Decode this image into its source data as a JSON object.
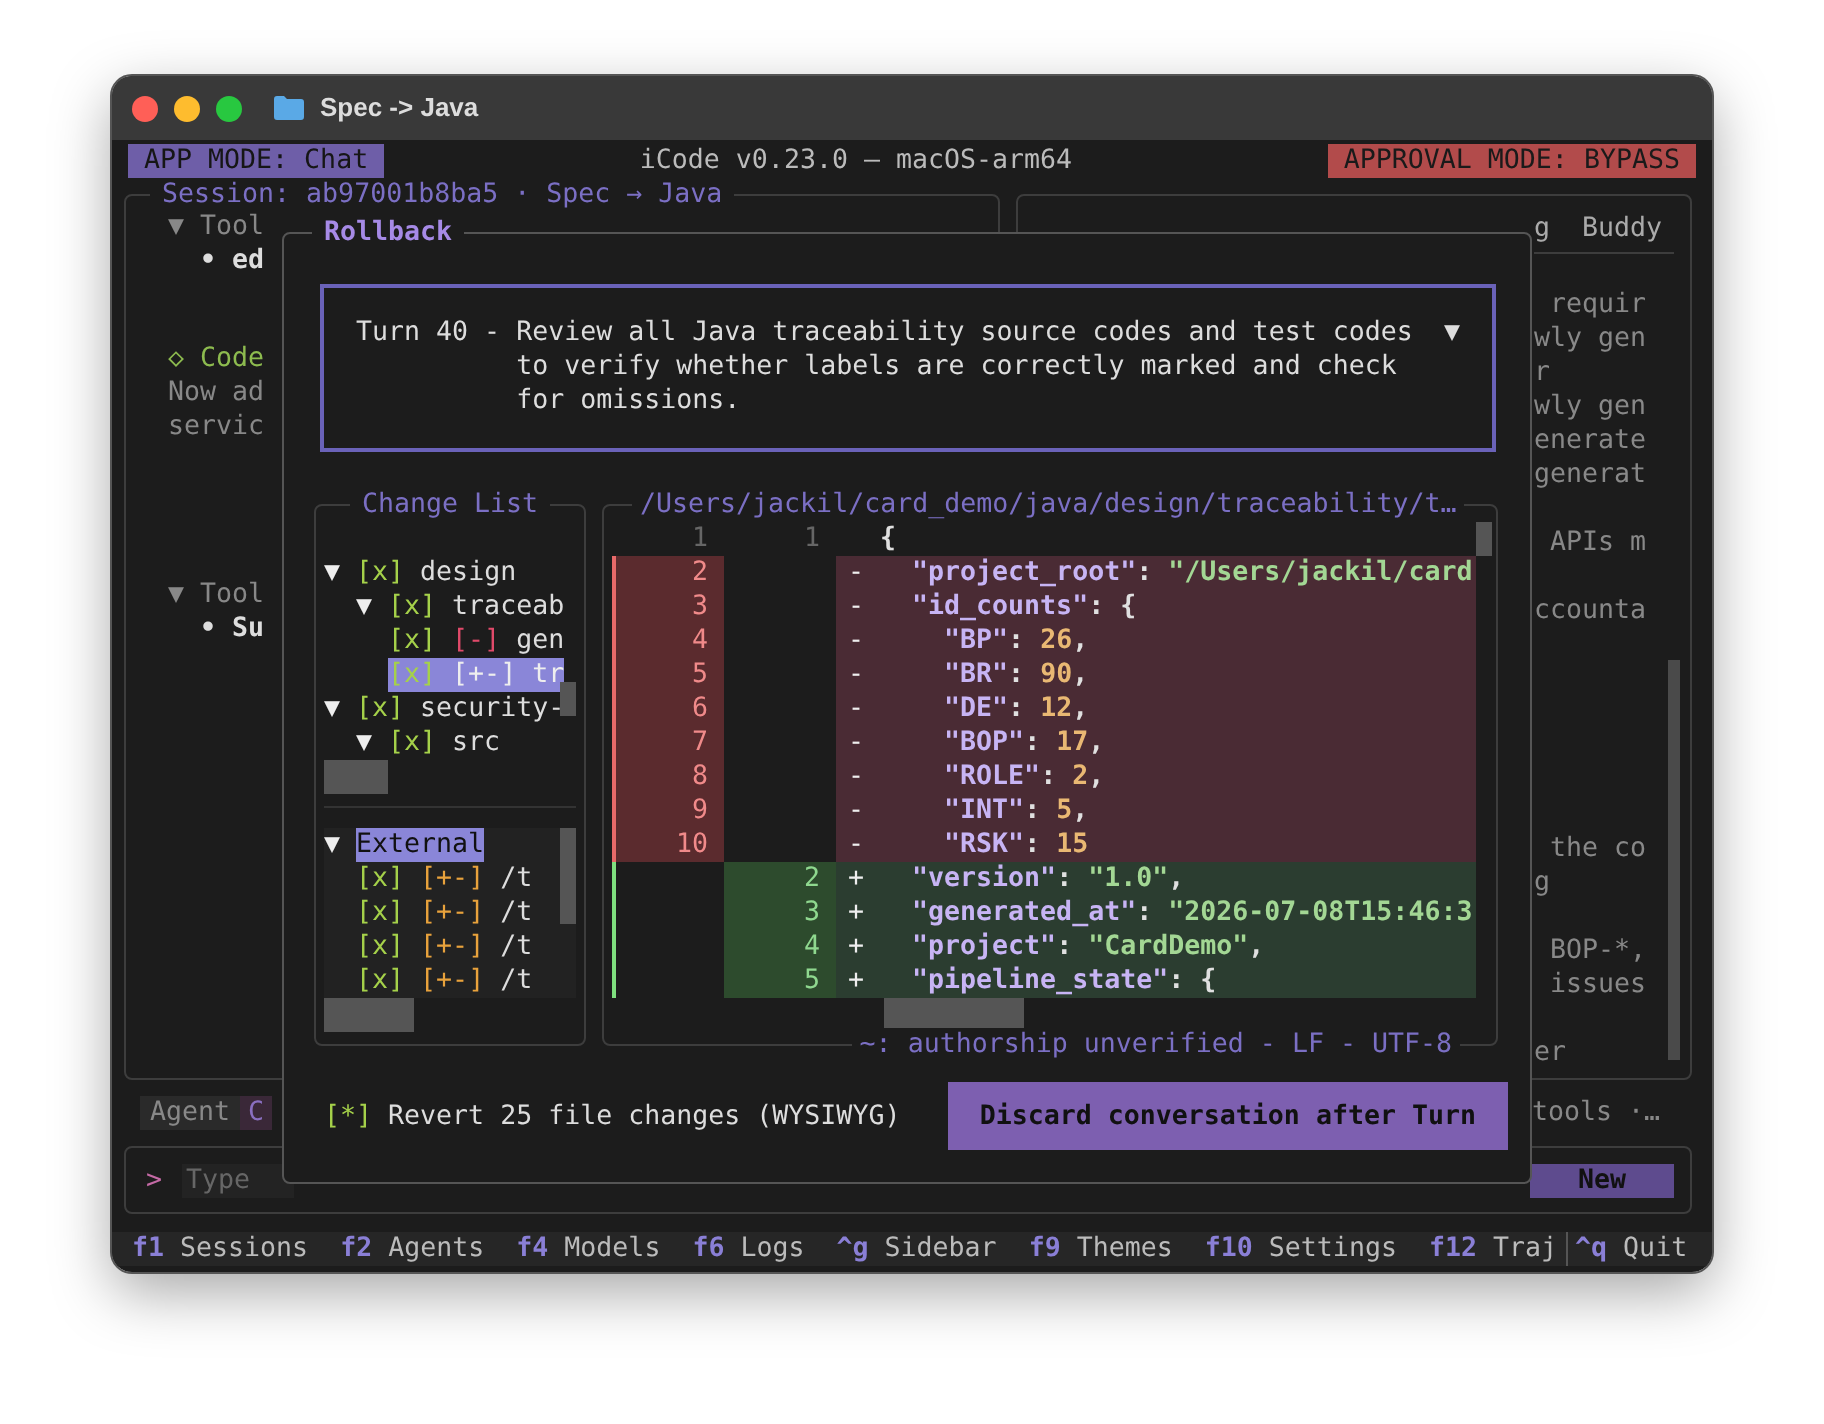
{
  "window": {
    "title": "Spec -> Java"
  },
  "header": {
    "app_mode": "APP MODE: Chat",
    "title": "iCode v0.23.0 — macOS-arm64",
    "approval_mode": "APPROVAL MODE: BYPASS"
  },
  "session_panel": {
    "title": "Session: ab97001b8ba5 · Spec → Java",
    "blocks": [
      {
        "kind": "tool",
        "lines": [
          "▼ Tool",
          "• ed"
        ]
      },
      {
        "kind": "message",
        "lines": [
          "◇ Code",
          "Now ad",
          "servic"
        ]
      },
      {
        "kind": "tool",
        "lines": [
          "▼ Tool",
          "• Su"
        ]
      }
    ]
  },
  "side_panel": {
    "tabs": [
      "g",
      "Buddy"
    ],
    "paragraphs": [
      [
        " requir",
        "wly gen",
        "r",
        "wly gen",
        "enerate",
        "generat"
      ],
      [
        " APIs m"
      ],
      [
        "ccounta"
      ],
      [
        " the co",
        "g"
      ],
      [
        " BOP-*,",
        " issues"
      ],
      [
        "er"
      ]
    ]
  },
  "agent_bar": {
    "label": "Agent",
    "value": "C",
    "tools": "tools ·…"
  },
  "input": {
    "prompt": ">",
    "placeholder": "Type",
    "button": "New"
  },
  "status_bar": [
    {
      "key": "f1",
      "label": "Sessions"
    },
    {
      "key": "f2",
      "label": "Agents"
    },
    {
      "key": "f4",
      "label": "Models"
    },
    {
      "key": "f6",
      "label": "Logs"
    },
    {
      "key": "^g",
      "label": "Sidebar"
    },
    {
      "key": "f9",
      "label": "Themes"
    },
    {
      "key": "f10",
      "label": "Settings"
    },
    {
      "key": "f12",
      "label": "Traj"
    },
    {
      "key": "^q",
      "label": "Quit"
    }
  ],
  "rollback": {
    "title": "Rollback",
    "turn": {
      "label": "Turn 40 -",
      "text": "Review all Java traceability source codes and test codes to verify whether labels are correctly marked and check for omissions.",
      "toggle": "▼"
    },
    "change_list": {
      "title": "Change List",
      "groups": [
        [
          {
            "toggle": "▼",
            "check": "[x]",
            "checked": true,
            "label": "design",
            "selected": false,
            "children": [
              {
                "toggle": "▼",
                "check": "[x]",
                "checked": true,
                "label": "traceab",
                "selected": false,
                "children": [
                  {
                    "check": "[x]",
                    "checked": true,
                    "change": "[-]",
                    "color": "#e04a6a",
                    "label": "gen",
                    "selected": false
                  },
                  {
                    "check": "[x]",
                    "checked": true,
                    "change": "[+-]",
                    "label": "tr",
                    "selected": true
                  }
                ]
              }
            ]
          },
          {
            "toggle": "▼",
            "check": "[x]",
            "checked": true,
            "label": "security-",
            "selected": false,
            "children": [
              {
                "toggle": "▼",
                "check": "[x]",
                "checked": true,
                "label": "src",
                "selected": false
              }
            ]
          }
        ],
        [
          {
            "toggle": "▼",
            "label": "External",
            "selected": true,
            "children": [
              {
                "check": "[x]",
                "checked": true,
                "change": "[+-]",
                "color": "#e8a23c",
                "label": "/t",
                "selected": false
              },
              {
                "check": "[x]",
                "checked": true,
                "change": "[+-]",
                "color": "#e8a23c",
                "label": "/t",
                "selected": false
              },
              {
                "check": "[x]",
                "checked": true,
                "change": "[+-]",
                "color": "#e8a23c",
                "label": "/t",
                "selected": false
              },
              {
                "check": "[x]",
                "checked": true,
                "change": "[+-]",
                "color": "#e8a23c",
                "label": "/t",
                "selected": false
              }
            ]
          }
        ]
      ]
    },
    "diff": {
      "title": "/Users/jackil/card_demo/java/design/traceability/t…",
      "footer": "~: authorship unverified - LF - UTF-8",
      "rows": [
        {
          "kind": "context",
          "old": "1",
          "new": "1",
          "tokens": [
            {
              "kind": "punct",
              "text": "{"
            }
          ]
        },
        {
          "kind": "removed",
          "old": "2",
          "sign": "-",
          "tokens": [
            {
              "kind": "key",
              "text": "  \"project_root\""
            },
            {
              "kind": "punct",
              "text": ": "
            },
            {
              "kind": "str",
              "text": "\"/Users/jackil/card"
            }
          ]
        },
        {
          "kind": "removed",
          "old": "3",
          "sign": "-",
          "tokens": [
            {
              "kind": "key",
              "text": "  \"id_counts\""
            },
            {
              "kind": "punct",
              "text": ": {"
            }
          ]
        },
        {
          "kind": "removed",
          "old": "4",
          "sign": "-",
          "tokens": [
            {
              "kind": "key",
              "text": "    \"BP\""
            },
            {
              "kind": "punct",
              "text": ": "
            },
            {
              "kind": "num",
              "text": "26"
            },
            {
              "kind": "punct",
              "text": ","
            }
          ]
        },
        {
          "kind": "removed",
          "old": "5",
          "sign": "-",
          "tokens": [
            {
              "kind": "key",
              "text": "    \"BR\""
            },
            {
              "kind": "punct",
              "text": ": "
            },
            {
              "kind": "num",
              "text": "90"
            },
            {
              "kind": "punct",
              "text": ","
            }
          ]
        },
        {
          "kind": "removed",
          "old": "6",
          "sign": "-",
          "tokens": [
            {
              "kind": "key",
              "text": "    \"DE\""
            },
            {
              "kind": "punct",
              "text": ": "
            },
            {
              "kind": "num",
              "text": "12"
            },
            {
              "kind": "punct",
              "text": ","
            }
          ]
        },
        {
          "kind": "removed",
          "old": "7",
          "sign": "-",
          "tokens": [
            {
              "kind": "key",
              "text": "    \"BOP\""
            },
            {
              "kind": "punct",
              "text": ": "
            },
            {
              "kind": "num",
              "text": "17"
            },
            {
              "kind": "punct",
              "text": ","
            }
          ]
        },
        {
          "kind": "removed",
          "old": "8",
          "sign": "-",
          "tokens": [
            {
              "kind": "key",
              "text": "    \"ROLE\""
            },
            {
              "kind": "punct",
              "text": ": "
            },
            {
              "kind": "num",
              "text": "2"
            },
            {
              "kind": "punct",
              "text": ","
            }
          ]
        },
        {
          "kind": "removed",
          "old": "9",
          "sign": "-",
          "tokens": [
            {
              "kind": "key",
              "text": "    \"INT\""
            },
            {
              "kind": "punct",
              "text": ": "
            },
            {
              "kind": "num",
              "text": "5"
            },
            {
              "kind": "punct",
              "text": ","
            }
          ]
        },
        {
          "kind": "removed",
          "old": "10",
          "sign": "-",
          "tokens": [
            {
              "kind": "key",
              "text": "    \"RSK\""
            },
            {
              "kind": "punct",
              "text": ": "
            },
            {
              "kind": "num",
              "text": "15"
            }
          ]
        },
        {
          "kind": "added",
          "new": "2",
          "sign": "+",
          "tokens": [
            {
              "kind": "key",
              "text": "  \"version\""
            },
            {
              "kind": "punct",
              "text": ": "
            },
            {
              "kind": "str",
              "text": "\"1.0\""
            },
            {
              "kind": "punct",
              "text": ","
            }
          ]
        },
        {
          "kind": "added",
          "new": "3",
          "sign": "+",
          "tokens": [
            {
              "kind": "key",
              "text": "  \"generated_at\""
            },
            {
              "kind": "punct",
              "text": ": "
            },
            {
              "kind": "str",
              "text": "\"2026-07-08T15:46:3"
            }
          ]
        },
        {
          "kind": "added",
          "new": "4",
          "sign": "+",
          "tokens": [
            {
              "kind": "key",
              "text": "  \"project\""
            },
            {
              "kind": "punct",
              "text": ": "
            },
            {
              "kind": "str",
              "text": "\"CardDemo\""
            },
            {
              "kind": "punct",
              "text": ","
            }
          ]
        },
        {
          "kind": "added",
          "new": "5",
          "sign": "+",
          "tokens": [
            {
              "kind": "key",
              "text": "  \"pipeline_state\""
            },
            {
              "kind": "punct",
              "text": ": {"
            }
          ]
        }
      ]
    },
    "revert": {
      "mark": "[*]",
      "checked": true,
      "label": "Revert 25 file changes (WYSIWYG)"
    },
    "discard_button": "Discard conversation after Turn"
  }
}
